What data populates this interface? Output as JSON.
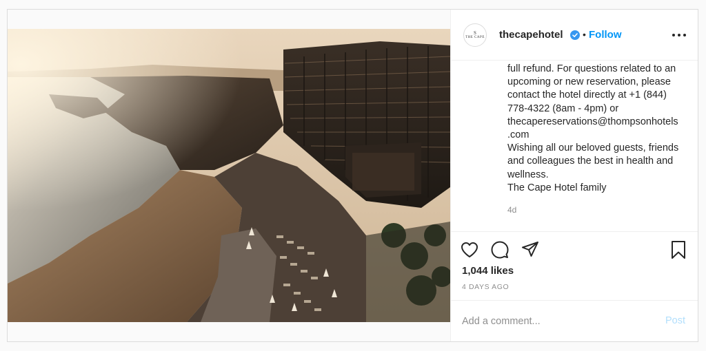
{
  "post": {
    "username": "thecapehotel",
    "avatar_mark": "S",
    "avatar_brand": "THE CAPE",
    "separator": "•",
    "follow_label": "Follow",
    "caption": "full refund. For questions related to an\nupcoming or new reservation, please\ncontact the hotel directly at +1 (844)\n778-4322 (8am - 4pm) or\nthecapereservations@thompsonhotels\n.com\nWishing all our beloved guests, friends\nand colleagues the best in health and\nwellness.\nThe Cape Hotel family",
    "caption_time": "4d",
    "likes": "1,044 likes",
    "posted_ago": "4 DAYS AGO",
    "comment_placeholder": "Add a comment...",
    "post_label": "Post"
  },
  "icons": {
    "verified": "verified-badge-icon",
    "more": "more-options-icon",
    "like": "heart-icon",
    "comment": "comment-icon",
    "share": "share-icon",
    "save": "bookmark-icon"
  },
  "colors": {
    "accent": "#0095f6",
    "post_disabled": "#b2dffc",
    "muted": "#8e8e8e",
    "border": "#dbdbdb"
  }
}
